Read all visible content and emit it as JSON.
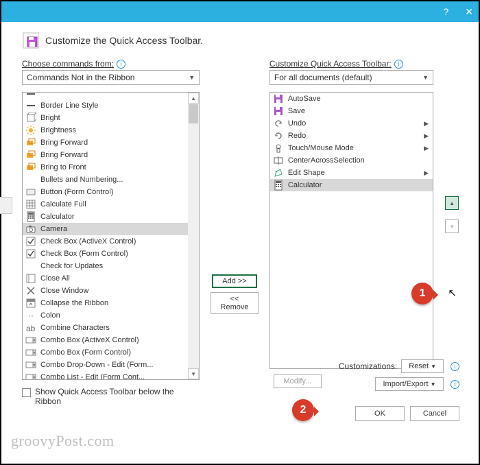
{
  "titlebar": {
    "help": "?",
    "close": "✕"
  },
  "header": {
    "title": "Customize the Quick Access Toolbar."
  },
  "left": {
    "label": "Choose commands from:",
    "combo": "Commands Not in the Ribbon",
    "items": [
      {
        "label": "",
        "icon": "line",
        "submenu": false,
        "cutoff": true
      },
      {
        "label": "Border Line Style",
        "icon": "line",
        "submenu": true
      },
      {
        "label": "Bright",
        "icon": "cube",
        "submenu": false
      },
      {
        "label": "Brightness",
        "icon": "sun",
        "submenu": true
      },
      {
        "label": "Bring Forward",
        "icon": "layers-orange",
        "submenu": false
      },
      {
        "label": "Bring Forward",
        "icon": "layers-orange",
        "submenu": true,
        "sep": true
      },
      {
        "label": "Bring to Front",
        "icon": "layers-orange",
        "submenu": false
      },
      {
        "label": "Bullets and Numbering...",
        "icon": "none",
        "submenu": false
      },
      {
        "label": "Button (Form Control)",
        "icon": "button",
        "submenu": false
      },
      {
        "label": "Calculate Full",
        "icon": "sheet",
        "submenu": false
      },
      {
        "label": "Calculator",
        "icon": "calc",
        "submenu": false
      },
      {
        "label": "Camera",
        "icon": "camera",
        "submenu": false,
        "selected": true
      },
      {
        "label": "Check Box (ActiveX Control)",
        "icon": "check",
        "submenu": false
      },
      {
        "label": "Check Box (Form Control)",
        "icon": "check",
        "submenu": false
      },
      {
        "label": "Check for Updates",
        "icon": "none",
        "submenu": false
      },
      {
        "label": "Close All",
        "icon": "close",
        "submenu": false
      },
      {
        "label": "Close Window",
        "icon": "closex",
        "submenu": false
      },
      {
        "label": "Collapse the Ribbon",
        "icon": "collapse",
        "submenu": false
      },
      {
        "label": "Colon",
        "icon": "colon",
        "submenu": false
      },
      {
        "label": "Combine Characters",
        "icon": "combine",
        "submenu": false
      },
      {
        "label": "Combo Box (ActiveX Control)",
        "icon": "combo",
        "submenu": false
      },
      {
        "label": "Combo Box (Form Control)",
        "icon": "combo",
        "submenu": false
      },
      {
        "label": "Combo Drop-Down - Edit (Form...",
        "icon": "combo",
        "submenu": false
      },
      {
        "label": "Combo List - Edit (Form Cont...",
        "icon": "combo",
        "submenu": false
      }
    ]
  },
  "right": {
    "label": "Customize Quick Access Toolbar:",
    "combo": "For all documents (default)",
    "items": [
      {
        "label": "AutoSave",
        "icon": "save-purple",
        "submenu": false
      },
      {
        "label": "Save",
        "icon": "save-purple",
        "submenu": false
      },
      {
        "label": "Undo",
        "icon": "undo",
        "submenu": true
      },
      {
        "label": "Redo",
        "icon": "redo",
        "submenu": true
      },
      {
        "label": "Touch/Mouse Mode",
        "icon": "touch",
        "submenu": true
      },
      {
        "label": "CenterAcrossSelection",
        "icon": "center",
        "submenu": false
      },
      {
        "label": "Edit Shape",
        "icon": "editshape",
        "submenu": true
      },
      {
        "label": "Calculator",
        "icon": "calc",
        "submenu": false,
        "selected": true
      }
    ],
    "modify": "Modify..."
  },
  "mid": {
    "add": "Add >>",
    "remove": "<< Remove"
  },
  "bottom": {
    "show_below": "Show Quick Access Toolbar below the Ribbon",
    "customizations": "Customizations:",
    "reset": "Reset",
    "import_export": "Import/Export"
  },
  "footer": {
    "ok": "OK",
    "cancel": "Cancel"
  },
  "watermark": "groovyPost.com",
  "callouts": {
    "c1": "1",
    "c2": "2"
  }
}
